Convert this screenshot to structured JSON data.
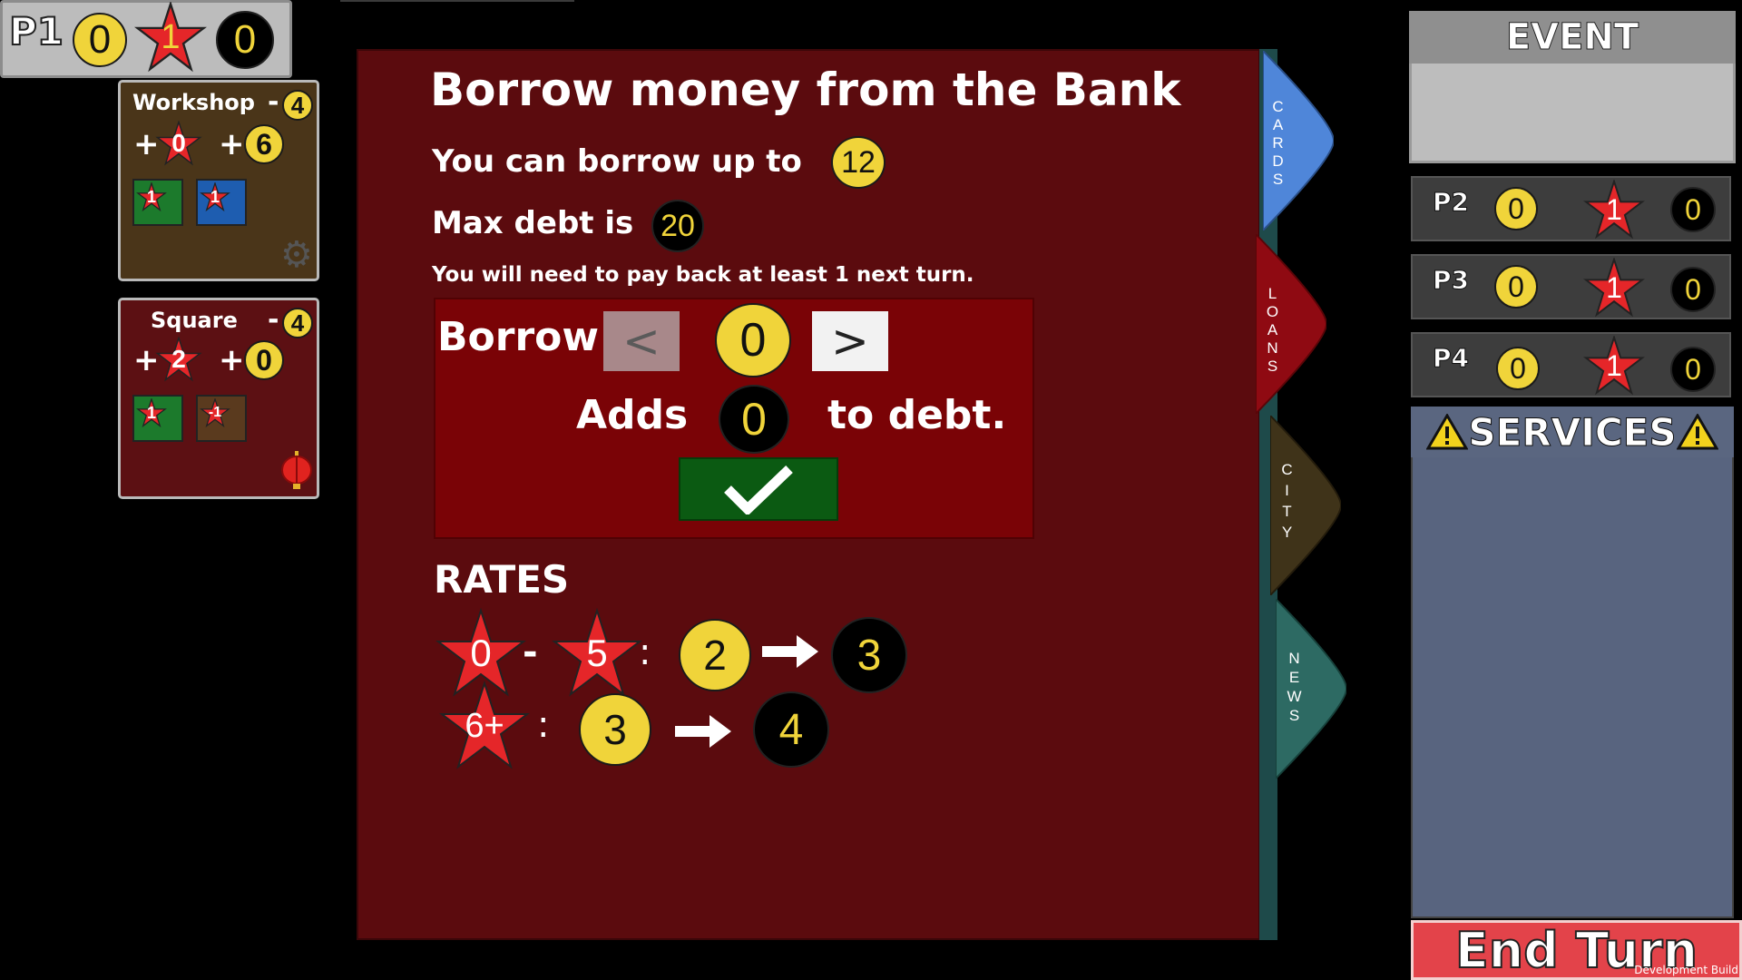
{
  "player": {
    "label": "P1",
    "money": "0",
    "stars": "1",
    "debt": "0"
  },
  "buildings": [
    {
      "name": "Workshop",
      "cost_sign": "-",
      "cost": "4",
      "star_gain": "0",
      "money_gain": "6",
      "tiles": [
        "1",
        "1"
      ],
      "icon": "gear-icon"
    },
    {
      "name": "Square",
      "cost_sign": "-",
      "cost": "4",
      "star_gain": "2",
      "money_gain": "0",
      "tiles": [
        "1",
        "-1"
      ],
      "icon": "lantern-icon"
    }
  ],
  "loan_panel": {
    "title": "Borrow money from the Bank",
    "can_borrow_label": "You can borrow up to",
    "can_borrow_value": "12",
    "max_debt_label": "Max debt is",
    "max_debt_value": "20",
    "payback_note": "You will need to pay back at least 1 next turn.",
    "borrow_label": "Borrow",
    "decrease_label": "<",
    "increase_label": ">",
    "borrow_amount": "0",
    "adds_label": "Adds",
    "adds_value": "0",
    "to_debt_label": "to debt."
  },
  "rates": {
    "title": "RATES",
    "rows": [
      {
        "stars_from": "0",
        "dash": "-",
        "stars_to": "5",
        "colon": ":",
        "money": "2",
        "debt": "3"
      },
      {
        "stars": "6+",
        "colon": ":",
        "money": "3",
        "debt": "4"
      }
    ]
  },
  "tabs": [
    {
      "label": "CARDS",
      "color": "#4f86d9"
    },
    {
      "label": "LOANS",
      "color": "#8f0a12"
    },
    {
      "label": "CITY",
      "color": "#3f3319"
    },
    {
      "label": "NEWS",
      "color": "#2d6a63"
    }
  ],
  "event": {
    "title": "EVENT"
  },
  "opponents": [
    {
      "label": "P2",
      "money": "0",
      "stars": "1",
      "debt": "0"
    },
    {
      "label": "P3",
      "money": "0",
      "stars": "1",
      "debt": "0"
    },
    {
      "label": "P4",
      "money": "0",
      "stars": "1",
      "debt": "0"
    }
  ],
  "services": {
    "title": "SERVICES"
  },
  "end_turn": {
    "label": "End Turn"
  },
  "dev_build": "Development Build",
  "colors": {
    "panel": "#5b0b0e",
    "coin": "#f0d43a",
    "star": "#e52629",
    "confirm": "#0b5a12",
    "end_turn": "#e3434a"
  }
}
